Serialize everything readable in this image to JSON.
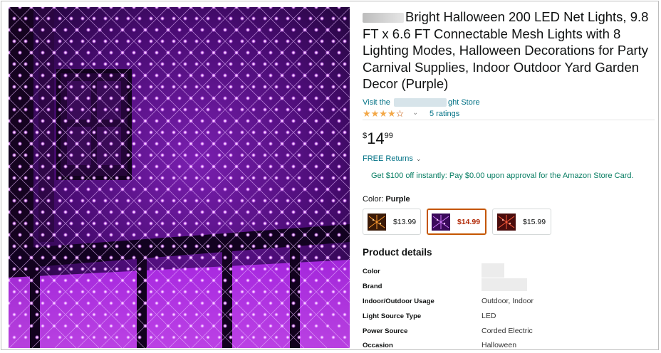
{
  "product": {
    "title": "Bright Halloween 200 LED Net Lights, 9.8 FT x 6.6 FT Connectable Mesh Lights with 8 Lighting Modes, Halloween Decorations for Party Carnival Supplies, Indoor Outdoor Yard Garden Decor (Purple)",
    "store_prefix": "Visit the",
    "store_suffix": "ght Store",
    "rating": 4.0,
    "ratings_label": "5 ratings",
    "price_currency": "$",
    "price_whole": "14",
    "price_fraction": "99",
    "returns_label": "FREE Returns",
    "promo_text": "Get $100 off instantly: Pay $0.00 upon approval for the Amazon Store Card.",
    "color_label": "Color:",
    "color_value": "Purple"
  },
  "icons": {
    "stars": "star-rating-icon",
    "chevron": "chevron-down-icon"
  },
  "swatches": [
    {
      "price": "$13.99",
      "selected": false,
      "theme": "orange"
    },
    {
      "price": "$14.99",
      "selected": true,
      "theme": "purple"
    },
    {
      "price": "$15.99",
      "selected": false,
      "theme": "red"
    }
  ],
  "details": {
    "heading": "Product details",
    "rows": [
      {
        "key": "Color",
        "value": ""
      },
      {
        "key": "Brand",
        "value": ""
      },
      {
        "key": "Indoor/Outdoor Usage",
        "value": "Outdoor, Indoor"
      },
      {
        "key": "Light Source Type",
        "value": "LED"
      },
      {
        "key": "Power Source",
        "value": "Corded Electric"
      },
      {
        "key": "Occasion",
        "value": "Halloween"
      }
    ]
  },
  "colors": {
    "link": "#007185",
    "promo": "#067d62",
    "star": "#f3a847",
    "selected_border": "#c45500",
    "selected_price": "#b12704",
    "glow": "#b400ff"
  }
}
